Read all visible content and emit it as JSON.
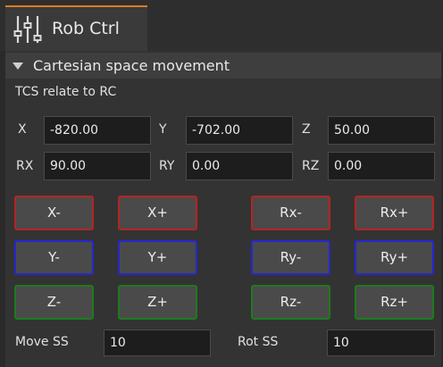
{
  "tab": {
    "label": "Rob Ctrl",
    "icon": "sliders-icon",
    "accent": "#e07a22"
  },
  "section": {
    "title": "Cartesian space movement",
    "icon": "triangle-down-icon"
  },
  "subtitle": "TCS relate to RC",
  "coords": {
    "x": {
      "label": "X",
      "value": "-820.00"
    },
    "y": {
      "label": "Y",
      "value": "-702.00"
    },
    "z": {
      "label": "Z",
      "value": "50.00"
    },
    "rx": {
      "label": "RX",
      "value": "90.00"
    },
    "ry": {
      "label": "RY",
      "value": "0.00"
    },
    "rz": {
      "label": "RZ",
      "value": "0.00"
    }
  },
  "jog": {
    "x_minus": "X-",
    "x_plus": "X+",
    "rx_minus": "Rx-",
    "rx_plus": "Rx+",
    "y_minus": "Y-",
    "y_plus": "Y+",
    "ry_minus": "Ry-",
    "ry_plus": "Ry+",
    "z_minus": "Z-",
    "z_plus": "Z+",
    "rz_minus": "Rz-",
    "rz_plus": "Rz+"
  },
  "colors": {
    "x_axis": "#b52424",
    "y_axis": "#2626d0",
    "z_axis": "#1e7a1e"
  },
  "speed": {
    "move_label": "Move SS",
    "move_value": "10",
    "rot_label": "Rot SS",
    "rot_value": "10"
  }
}
